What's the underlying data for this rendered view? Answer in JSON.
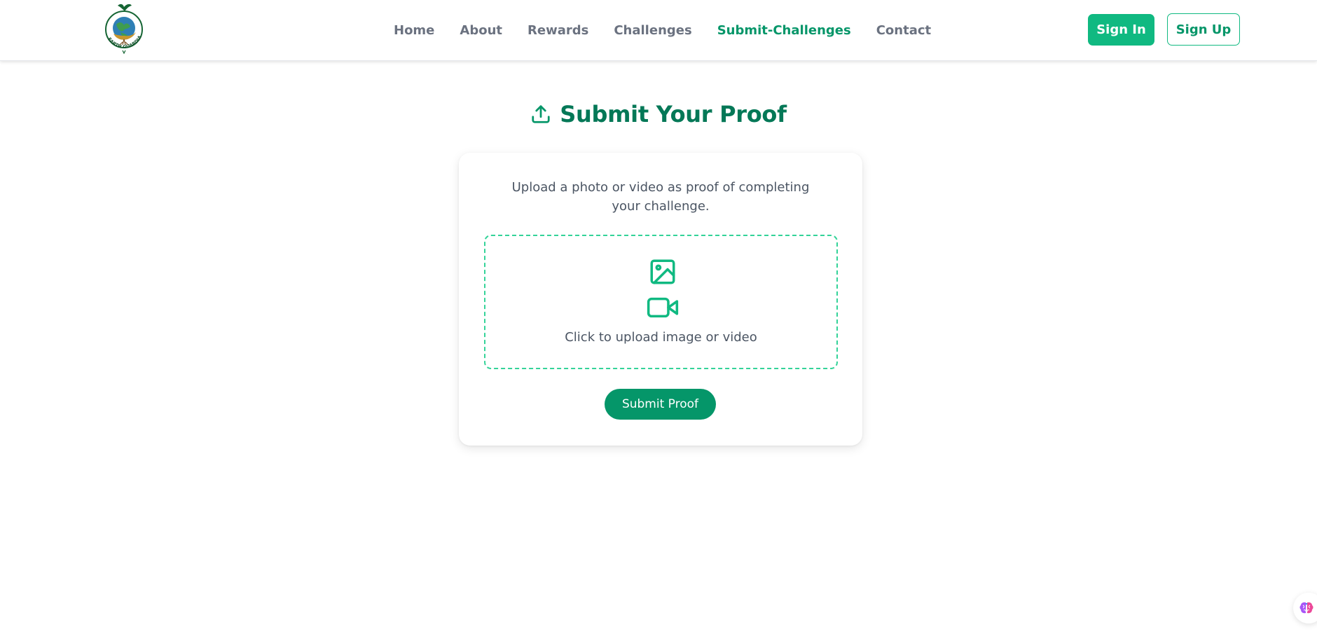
{
  "brand": {
    "logo_text": "EARTH GUARDIANS",
    "colors": {
      "primary": "#10b981",
      "primary_dark": "#059669",
      "title": "#047857"
    }
  },
  "nav": {
    "links": [
      {
        "label": "Home"
      },
      {
        "label": "About"
      },
      {
        "label": "Rewards"
      },
      {
        "label": "Challenges"
      },
      {
        "label": "Submit-Challenges",
        "active": true
      },
      {
        "label": "Contact"
      }
    ],
    "sign_in": "Sign In",
    "sign_up": "Sign Up"
  },
  "page": {
    "title": "Submit Your Proof",
    "title_icon": "upload-icon"
  },
  "card": {
    "description": "Upload a photo or video as proof of completing your challenge.",
    "dropzone": {
      "icons": [
        "image-icon",
        "video-icon"
      ],
      "text": "Click to upload image or video"
    },
    "submit_label": "Submit Proof"
  },
  "widget": {
    "icon": "brain-icon"
  }
}
